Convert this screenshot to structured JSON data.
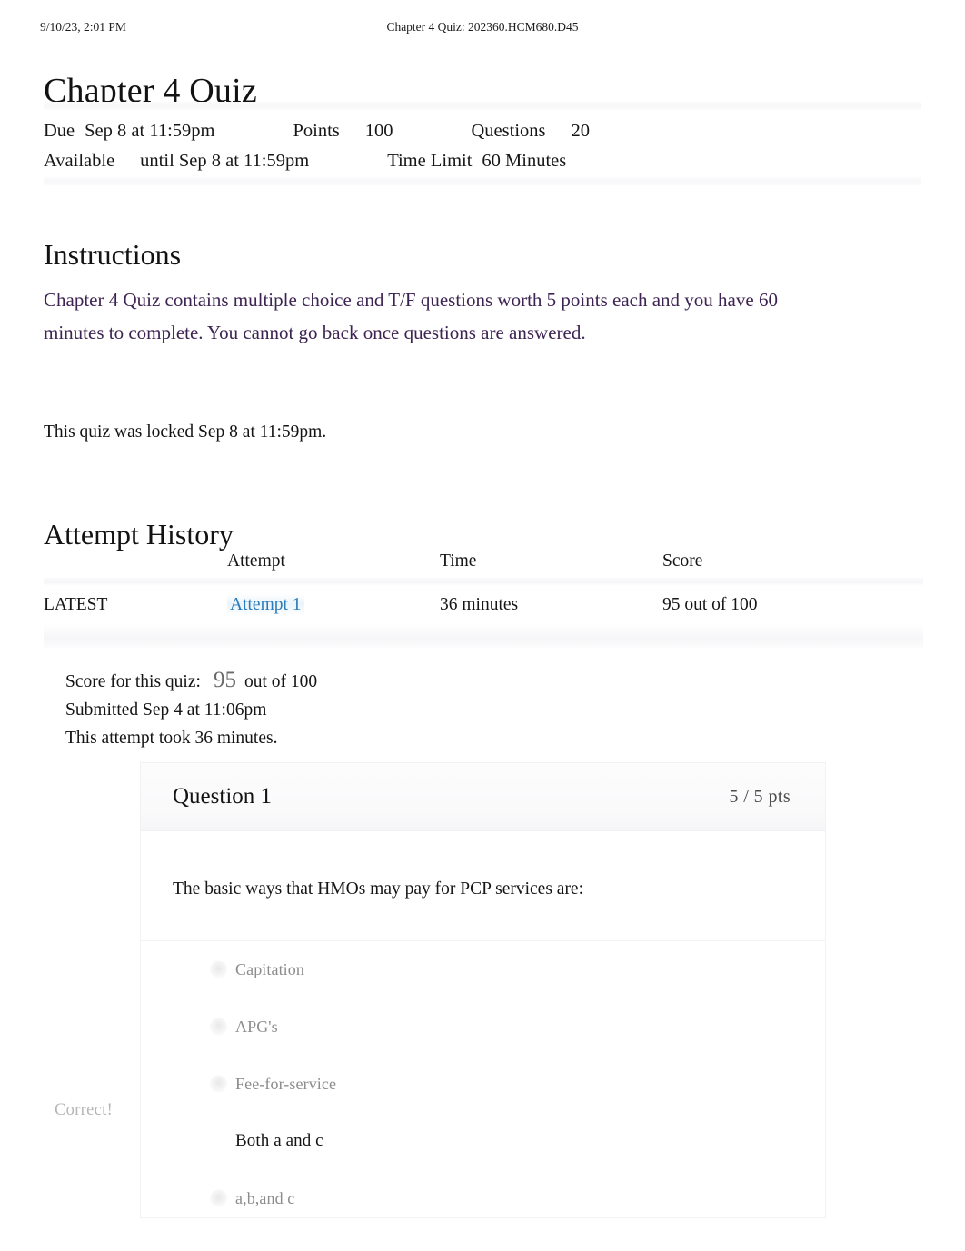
{
  "print_header": {
    "date": "9/10/23, 2:01 PM",
    "title": "Chapter 4 Quiz: 202360.HCM680.D45"
  },
  "page_title": "Chapter 4 Quiz",
  "quiz_details": {
    "due_label": "Due",
    "due_value": "Sep 8 at 11:59pm",
    "points_label": "Points",
    "points_value": "100",
    "questions_label": "Questions",
    "questions_value": "20",
    "available_label": "Available",
    "available_value": "until Sep 8 at 11:59pm",
    "time_limit_label": "Time Limit",
    "time_limit_value": "60 Minutes"
  },
  "instructions": {
    "heading": "Instructions",
    "body": "Chapter 4 Quiz contains multiple choice and T/F questions worth 5 points each and you have 60 minutes to complete. You cannot go back once questions are answered.",
    "locked_note": "This quiz was locked Sep 8 at 11:59pm.",
    "text_color": "#3d2352"
  },
  "attempt_history": {
    "heading": "Attempt History",
    "columns": [
      "",
      "Attempt",
      "Time",
      "Score"
    ],
    "rows": [
      {
        "flag": "LATEST",
        "attempt": "Attempt 1",
        "attempt_link_color": "#2b7bb9",
        "time": "36 minutes",
        "score": "95 out of 100"
      }
    ]
  },
  "score_summary": {
    "score_label": "Score for this quiz:",
    "score_value": "95",
    "score_out_of": "out of 100",
    "submitted": "Submitted Sep 4 at 11:06pm",
    "duration": "This attempt took 36 minutes."
  },
  "question": {
    "title": "Question 1",
    "points": "5 / 5 pts",
    "prompt": "The basic ways that HMOs may pay for PCP services are:",
    "correct_flag": "Correct!",
    "answers": [
      {
        "label": "Capitation",
        "selected": false
      },
      {
        "label": "APG's",
        "selected": false
      },
      {
        "label": "Fee-for-service",
        "selected": false
      },
      {
        "label": "Both a and c",
        "selected": true
      },
      {
        "label": "a,b,and c",
        "selected": false
      }
    ]
  }
}
